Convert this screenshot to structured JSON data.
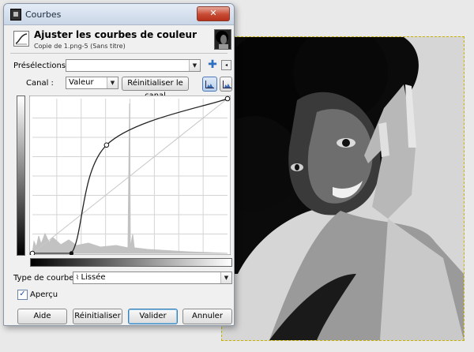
{
  "window": {
    "title": "Courbes",
    "close_label": "✕"
  },
  "header": {
    "title": "Ajuster les courbes de couleur",
    "subtitle": "Copie de 1.png-5 (Sans titre)"
  },
  "presets": {
    "label": "Présélections :",
    "value": "",
    "add_symbol": "✚",
    "menu_symbol": "◂"
  },
  "channel": {
    "label": "Canal :",
    "value": "Valeur",
    "reset_label": "Réinitialiser le canal"
  },
  "curve": {
    "type_label": "Type de courbe :",
    "type_value": "Lissée",
    "control_points": [
      [
        0,
        0
      ],
      [
        0.2,
        0
      ],
      [
        0.38,
        0.7
      ],
      [
        1,
        1
      ]
    ]
  },
  "preview": {
    "label": "Aperçu",
    "checked": true
  },
  "buttons": {
    "help": "Aide",
    "reset": "Réinitialiser",
    "ok": "Valider",
    "cancel": "Annuler"
  },
  "colors": {
    "selection_border": "#c8b400",
    "close_red": "#c74a33"
  }
}
